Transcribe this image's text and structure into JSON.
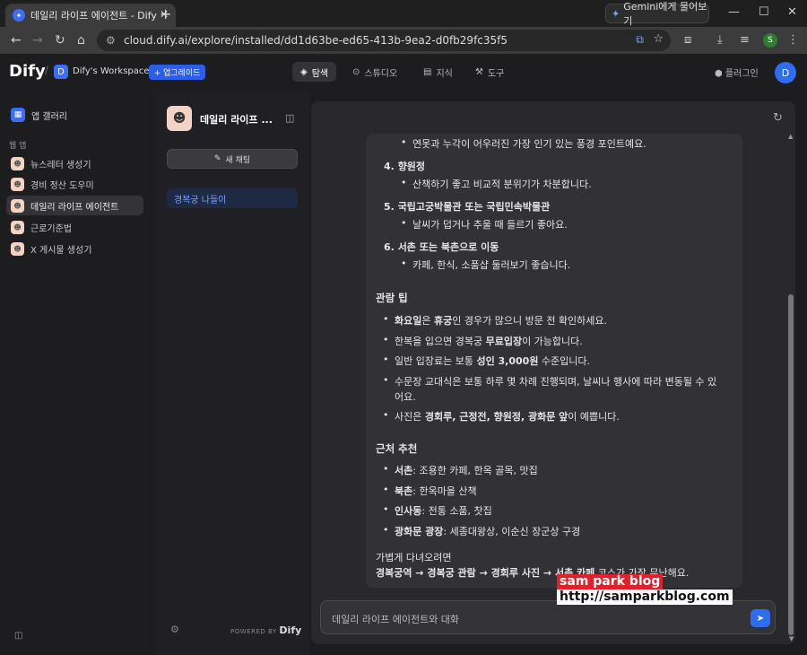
{
  "browser": {
    "tab_title": "데일리 라이프 에이전트 - Dify",
    "gemini_label": "Gemini에게 물어보기",
    "url": "cloud.dify.ai/explore/installed/dd1d63be-ed65-413b-9ea2-d0fb29fc35f5",
    "profile_initial": "S"
  },
  "header": {
    "logo": "Dify",
    "workspace_initial": "D",
    "workspace_name": "Dify's Workspace",
    "upgrade_label": "+ 업그레이드",
    "nav": [
      {
        "label": "탐색",
        "icon": "compass-icon"
      },
      {
        "label": "스튜디오",
        "icon": "robot-icon"
      },
      {
        "label": "지식",
        "icon": "book-icon"
      },
      {
        "label": "도구",
        "icon": "tool-icon"
      }
    ],
    "plugin_label": "플러그인",
    "avatar_initial": "D"
  },
  "sidebar": {
    "gallery_label": "앱 갤러리",
    "section_label": "웹 앱",
    "apps": [
      "뉴스레터 생성기",
      "경비 정산 도우미",
      "데일리 라이프 에이전트",
      "근로기준법",
      "X 게시물 생성기"
    ]
  },
  "chatlist": {
    "app_title": "데일리 라이프 ...",
    "new_chat_label": "새 채팅",
    "conversation": "경복궁 나들이",
    "powered_by": "POWERED BY",
    "powered_brand": "Dify"
  },
  "message": {
    "top_bullet": "연못과 누각이 어우러진 가장 인기 있는 풍경 포인트예요.",
    "places": [
      {
        "num": "4.",
        "name": "향원정",
        "desc": "산책하기 좋고 비교적 분위기가 차분합니다."
      },
      {
        "num": "5.",
        "name": "국립고궁박물관 또는 국립민속박물관",
        "desc": "날씨가 덥거나 추울 때 들르기 좋아요."
      },
      {
        "num": "6.",
        "name": "서촌 또는 북촌으로 이동",
        "desc": "카페, 한식, 소품샵 둘러보기 좋습니다."
      }
    ],
    "tips_heading": "관람 팁",
    "tips": [
      {
        "bold": "화요일",
        "mid": "은 ",
        "bold2": "휴궁",
        "rest": "인 경우가 많으니 방문 전 확인하세요."
      },
      {
        "bold": "",
        "mid": "한복을 입으면 경복궁 ",
        "bold2": "무료입장",
        "rest": "이 가능합니다."
      },
      {
        "bold": "",
        "mid": "일반 입장료는 보통 ",
        "bold2": "성인 3,000원",
        "rest": " 수준입니다."
      },
      {
        "bold": "",
        "mid": "수문장 교대식은 보통 하루 몇 차례 진행되며, 날씨나 행사에 따라 변동될 수 있",
        "bold2": "",
        "rest": ""
      },
      {
        "bold": "",
        "mid": "사진은 ",
        "bold2": "경회루, 근정전, 향원정, 광화문 앞",
        "rest": "이 예쁩니다."
      }
    ],
    "tip_wrap": "어요.",
    "nearby_heading": "근처 추천",
    "nearby": [
      {
        "name": "서촌",
        "desc": ": 조용한 카페, 한옥 골목, 맛집"
      },
      {
        "name": "북촌",
        "desc": ": 한옥마을 산책"
      },
      {
        "name": "인사동",
        "desc": ": 전통 소품, 찻집"
      },
      {
        "name": "광화문 광장",
        "desc": ": 세종대왕상, 이순신 장군상 구경"
      }
    ],
    "closing_intro": "가볍게 다녀오려면",
    "closing_route": "경복궁역 → 경복궁 관람 → 경회루 사진 → 서촌 카페",
    "closing_tail": " 코스가 가장 무난해요."
  },
  "input": {
    "placeholder": "데일리 라이프 에이전트와 대화"
  },
  "watermark": {
    "line1": "sam park blog",
    "line2": "http://samparkblog.com"
  }
}
